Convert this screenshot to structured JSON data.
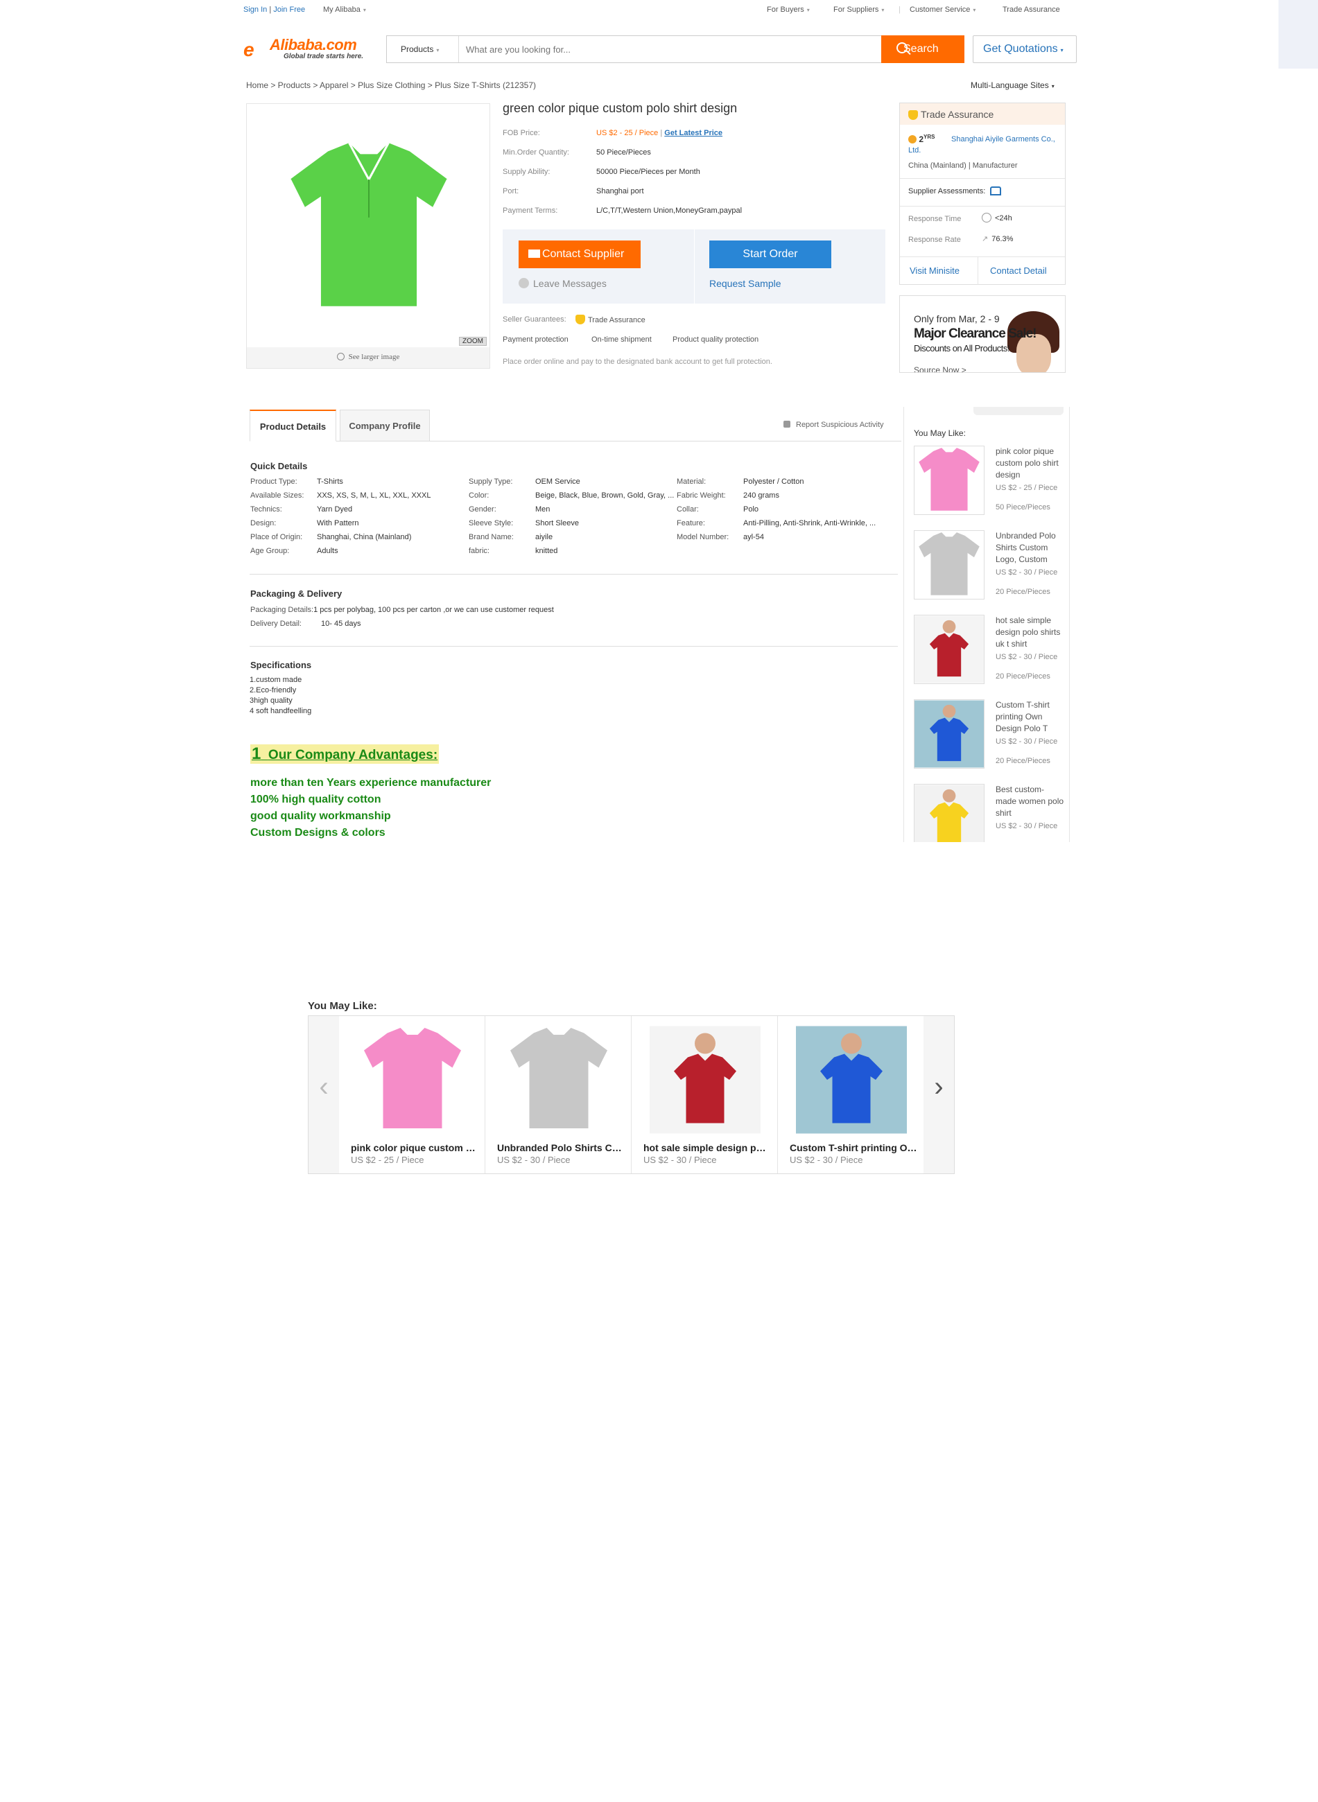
{
  "topbar": {
    "sign_in": "Sign In",
    "separator": "|",
    "join_free": "Join Free",
    "my_alibaba": "My Alibaba",
    "for_buyers": "For Buyers",
    "for_suppliers": "For Suppliers",
    "customer_service": "Customer Service",
    "trade_assurance": "Trade Assurance"
  },
  "logo": {
    "brand": "Alibaba.com",
    "tagline": "Global trade starts here."
  },
  "search": {
    "category": "Products",
    "placeholder": "What are you looking for...",
    "button": "Search",
    "quotations": "Get Quotations"
  },
  "breadcrumb": "Home > Products > Apparel > Plus Size Clothing > Plus Size T-Shirts (212357)",
  "multi_language": "Multi-Language Sites",
  "product": {
    "image_footer": "See larger image",
    "zoom": "ZOOM",
    "title": "green color pique custom polo shirt design",
    "rows": [
      {
        "label": "FOB Price:",
        "value": "US $2 - 25 / Piece"
      },
      {
        "label": "Min.Order Quantity:",
        "value": "50 Piece/Pieces"
      },
      {
        "label": "Supply Ability:",
        "value": "50000 Piece/Pieces per Month"
      },
      {
        "label": "Port:",
        "value": "Shanghai port"
      },
      {
        "label": "Payment Terms:",
        "value": "L/C,T/T,Western Union,MoneyGram,paypal"
      }
    ],
    "latest_price": "Get Latest Price",
    "contact_supplier": "Contact Supplier",
    "start_order": "Start Order",
    "leave_messages": "Leave Messages",
    "request_sample": "Request Sample",
    "seller_guarantees": "Seller Guarantees:",
    "trade_assurance": "Trade Assurance",
    "guarantees": [
      "Payment protection",
      "On-time shipment",
      "Product quality protection"
    ],
    "note": "Place order online and pay to the designated bank account to get full protection.",
    "color": "#5ad148"
  },
  "supplier": {
    "header": "Trade Assurance",
    "years": "2",
    "yrs": "YRS",
    "name": "Shanghai Aiyile Garments Co., Ltd.",
    "location": "China (Mainland) | Manufacturer",
    "assessments": "Supplier Assessments:",
    "response_time_label": "Response Time",
    "response_time": "<24h",
    "response_rate_label": "Response Rate",
    "response_rate": "76.3%",
    "visit_minisite": "Visit Minisite",
    "contact_detail": "Contact Detail"
  },
  "banner": {
    "line1": "Only from Mar, 2 - 9",
    "line2": "Major Clearance Sale!",
    "line3": "Discounts on All Products!",
    "line4": "Source Now >"
  },
  "tabs": {
    "details": "Product Details",
    "profile": "Company Profile",
    "report": "Report Suspicious Activity"
  },
  "quick_details": {
    "title": "Quick Details",
    "col1": [
      {
        "label": "Product Type:",
        "value": "T-Shirts"
      },
      {
        "label": "Available Sizes:",
        "value": "XXS, XS, S, M, L, XL, XXL, XXXL"
      },
      {
        "label": "Technics:",
        "value": "Yarn Dyed"
      },
      {
        "label": "Design:",
        "value": "With Pattern"
      },
      {
        "label": "Place of Origin:",
        "value": "Shanghai, China (Mainland)"
      },
      {
        "label": "Age Group:",
        "value": "Adults"
      }
    ],
    "col2": [
      {
        "label": "Supply Type:",
        "value": "OEM Service"
      },
      {
        "label": "Color:",
        "value": "Beige, Black, Blue, Brown, Gold, Gray, ..."
      },
      {
        "label": "Gender:",
        "value": "Men"
      },
      {
        "label": "Sleeve Style:",
        "value": "Short Sleeve"
      },
      {
        "label": "Brand Name:",
        "value": "aiyile"
      },
      {
        "label": "fabric:",
        "value": "knitted"
      }
    ],
    "col3": [
      {
        "label": "Material:",
        "value": "Polyester / Cotton"
      },
      {
        "label": "Fabric Weight:",
        "value": "240 grams"
      },
      {
        "label": "Collar:",
        "value": "Polo"
      },
      {
        "label": "Feature:",
        "value": "Anti-Pilling, Anti-Shrink, Anti-Wrinkle, ..."
      },
      {
        "label": "Model Number:",
        "value": "ayl-54"
      }
    ]
  },
  "packaging": {
    "title": "Packaging & Delivery",
    "details_label": "Packaging Details:",
    "details": "1 pcs per polybag, 100 pcs per carton ,or we can use customer request",
    "delivery_label": "Delivery Detail:",
    "delivery": "10- 45 days"
  },
  "specifications": {
    "title": "Specifications",
    "items": [
      "1.custom made",
      "2.Eco-friendly",
      "3high quality",
      "4 soft handfeelling"
    ]
  },
  "advantages": {
    "number": "1",
    "title": "Our   Company Advantages:",
    "items": [
      "more  than  ten Years experience manufacturer",
      "100% high   quality    cotton",
      "good  quality workmanship",
      "Custom Designs & colors"
    ]
  },
  "you_may_like_side": {
    "title": "You May Like:",
    "items": [
      {
        "name": "pink color pique custom polo shirt design",
        "price": "US $2 - 25 / Piece",
        "moq": "50 Piece/Pieces",
        "color": "#f58cc8"
      },
      {
        "name": "Unbranded Polo Shirts Custom Logo, Custom",
        "price": "US $2 - 30 / Piece",
        "moq": "20 Piece/Pieces",
        "color": "#c7c7c7"
      },
      {
        "name": "hot sale simple design polo shirts uk t shirt",
        "price": "US $2 - 30 / Piece",
        "moq": "20 Piece/Pieces",
        "color": "#b8202c"
      },
      {
        "name": "Custom T-shirt printing Own Design Polo T",
        "price": "US $2 - 30 / Piece",
        "moq": "20 Piece/Pieces",
        "color": "#1f58d6"
      },
      {
        "name": "Best custom-made women polo shirt",
        "price": "US $2 - 30 / Piece",
        "moq": "",
        "color": "#f7d21f"
      }
    ]
  },
  "you_may_like_bottom": {
    "title": "You May Like:",
    "prev": "‹",
    "next": "›",
    "items": [
      {
        "name": "pink color pique custom polo shirt design",
        "price": "US $2 - 25 / Piece",
        "color": "#f58cc8"
      },
      {
        "name": "Unbranded Polo Shirts Custom Logo, Custom",
        "price": "US $2 - 30 / Piece",
        "color": "#c7c7c7"
      },
      {
        "name": "hot sale simple design polo shirts uk t shirt",
        "price": "US $2 - 30 / Piece",
        "color": "#b8202c"
      },
      {
        "name": "Custom T-shirt printing Own Design Polo T",
        "price": "US $2 - 30 / Piece",
        "color": "#1f58d6"
      }
    ]
  },
  "colors": {
    "accent": "#ff6a00",
    "link": "#2773b9",
    "advantage_green": "#1a8a16"
  }
}
